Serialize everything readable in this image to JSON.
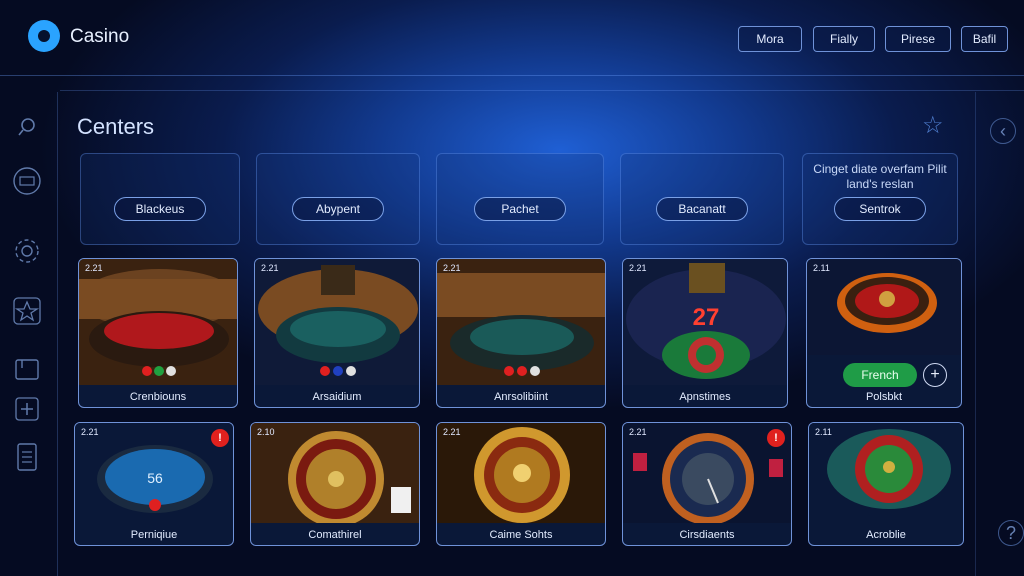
{
  "header": {
    "brand": "Casino",
    "nav": [
      "Mora",
      "Fially",
      "Pirese",
      "Bafil"
    ]
  },
  "sidebar_icons": [
    "search-icon",
    "media-icon",
    "settings-cog-icon",
    "star-outline-icon",
    "folder-icon",
    "add-icon",
    "document-icon"
  ],
  "section": {
    "title": "Centers"
  },
  "categories": [
    {
      "label": "Blackeus"
    },
    {
      "label": "Abypent"
    },
    {
      "label": "Pachet"
    },
    {
      "label": "Bacanatt"
    },
    {
      "label": "Sentrok",
      "note": "Cinget diate overfam Pilit land's reslan"
    }
  ],
  "games_row1": [
    {
      "time": "2.21",
      "label": "Crenbiouns"
    },
    {
      "time": "2.21",
      "label": "Arsaidium"
    },
    {
      "time": "2.21",
      "label": "Anrsolibiint"
    },
    {
      "time": "2.21",
      "label": "Apnstimes"
    },
    {
      "time": "2.11",
      "label": "Polsbkt",
      "play_label": "French",
      "plus_label": "+"
    }
  ],
  "games_row2": [
    {
      "time": "2.21",
      "label": "Perniqiue",
      "badge": "!"
    },
    {
      "time": "2.10",
      "label": "Comathirel"
    },
    {
      "time": "2.21",
      "label": "Caime Sohts"
    },
    {
      "time": "2.21",
      "label": "Cirsdiaents",
      "badge": "!"
    },
    {
      "time": "2.11",
      "label": "Acroblie"
    }
  ],
  "colors": {
    "accent": "#2aa3ff",
    "play": "#1f9c47",
    "badge": "#e0211e"
  }
}
